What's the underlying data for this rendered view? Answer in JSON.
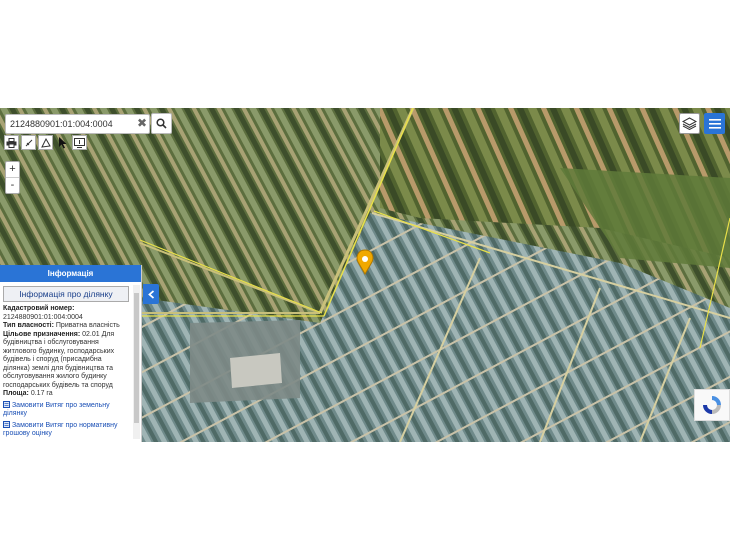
{
  "search": {
    "value": "2124880901:01:004:0004",
    "clear_label": "✖"
  },
  "toolbar": {
    "tools": [
      "print-icon",
      "ruler-icon",
      "area-measure-icon",
      "pointer-icon",
      "info-icon"
    ]
  },
  "zoom": {
    "in_label": "+",
    "out_label": "-"
  },
  "info_panel": {
    "header": "Інформація",
    "section_title": "Інформація про ділянку",
    "cadastral_label": "Кадастровий номер:",
    "cadastral_value": "2124880901:01:004:0004",
    "ownership_label": "Тип власності:",
    "ownership_value": " Приватна власність",
    "purpose_label": "Цільове призначення:",
    "purpose_value": " 02.01 Для будівництва і обслуговування житлового будинку, господарських будівель і споруд (присадибна ділянка) землі для будівництва та обслуговування жилого будинку господарських будівель та споруд",
    "area_label": "Площа:",
    "area_value": " 0.17 га",
    "link_extract": "Замовити Витяг про земельну ділянку",
    "link_normative": "Замовити Витяг про нормативну грошову оцінку"
  },
  "colors": {
    "accent": "#2a74d6",
    "marker": "#f0a800",
    "boundary": "#e8e04a"
  }
}
